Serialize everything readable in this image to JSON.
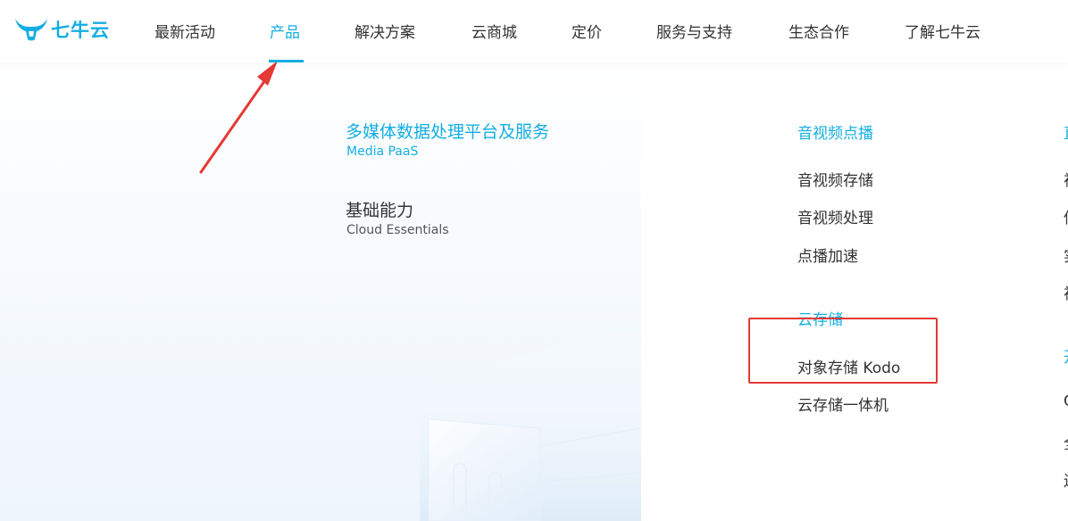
{
  "brand": {
    "name": "七牛云",
    "accent_color": "#14aee2"
  },
  "nav": {
    "items": [
      {
        "label": "最新活动"
      },
      {
        "label": "产品",
        "active": true
      },
      {
        "label": "解决方案"
      },
      {
        "label": "云商城"
      },
      {
        "label": "定价"
      },
      {
        "label": "服务与支持"
      },
      {
        "label": "生态合作"
      },
      {
        "label": "了解七牛云"
      }
    ]
  },
  "categories": [
    {
      "title": "多媒体数据处理平台及服务",
      "subtitle": "Media PaaS",
      "active": true
    },
    {
      "title": "基础能力",
      "subtitle": "Cloud Essentials",
      "active": false
    }
  ],
  "groups": [
    {
      "title": "音视频点播",
      "links": [
        "音视频存储",
        "音视频处理",
        "点播加速"
      ]
    },
    {
      "title": "云存储",
      "links": [
        "对象存储 Kodo",
        "云存储一体机"
      ]
    }
  ],
  "annotations": {
    "highlight_color": "#e53935"
  }
}
